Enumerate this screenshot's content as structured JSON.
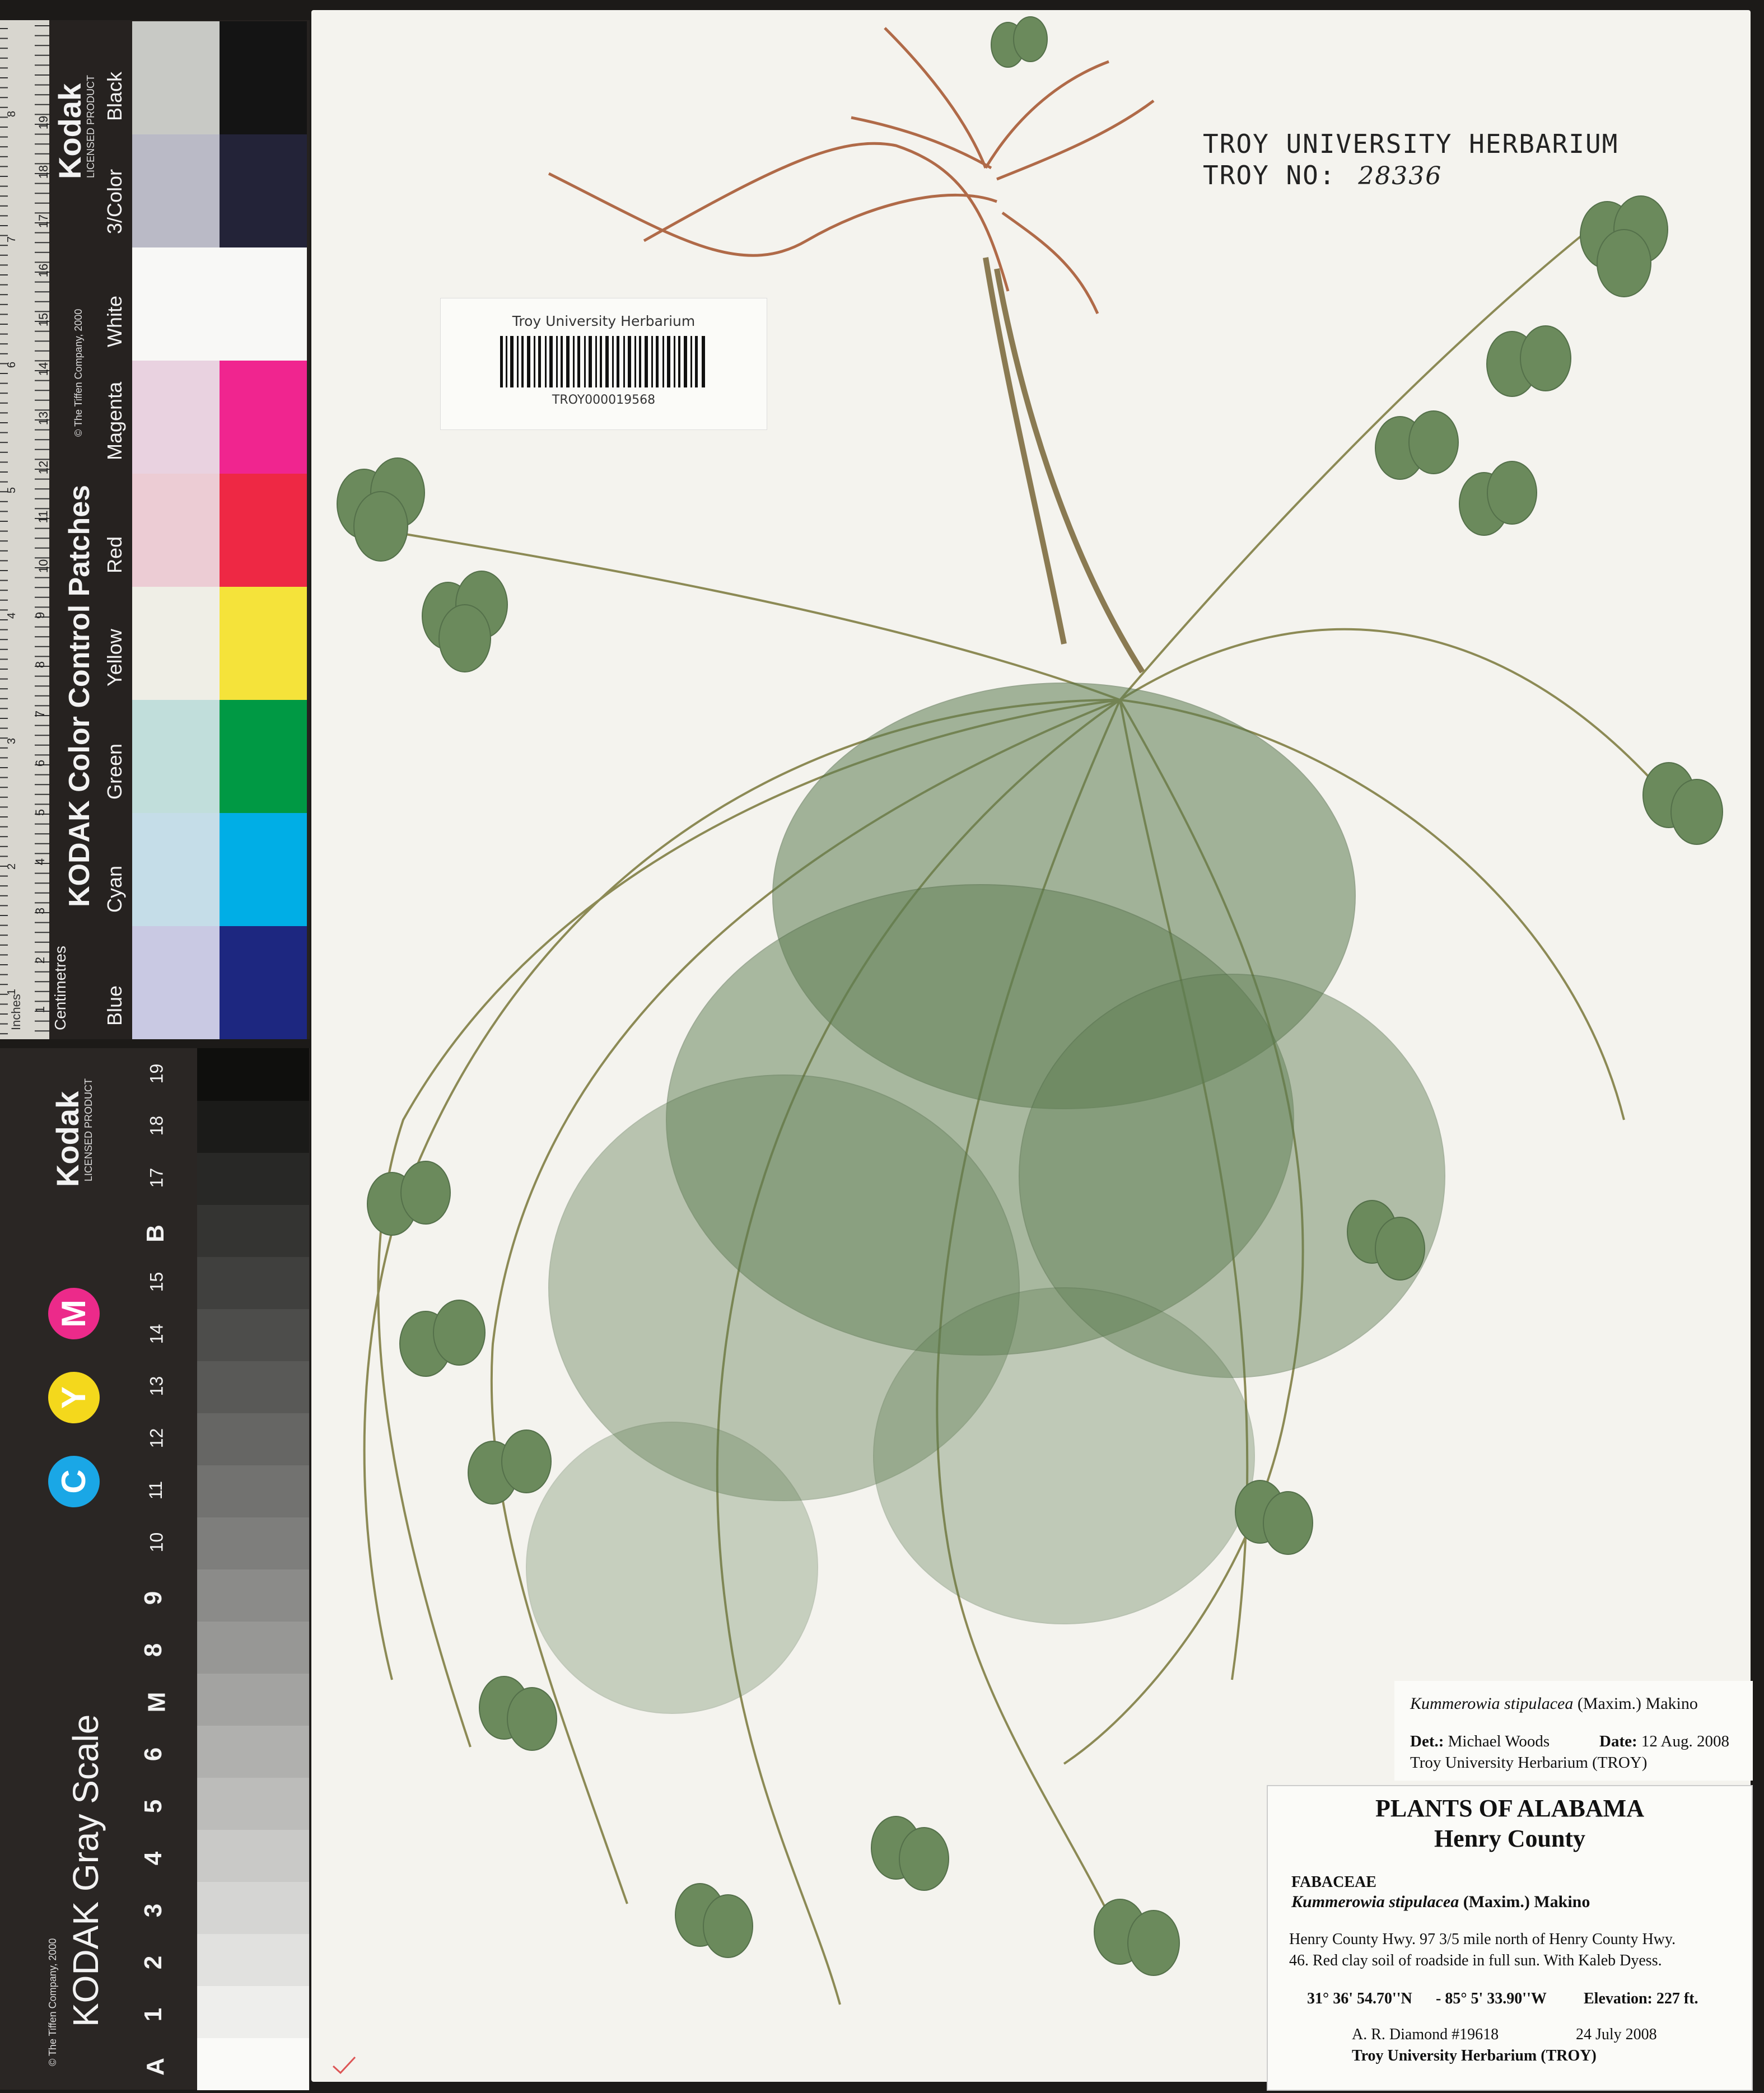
{
  "sheet": {
    "stamp_line1": "TROY UNIVERSITY HERBARIUM",
    "stamp_line2_prefix": "TROY NO:",
    "stamp_line2_number": "28336"
  },
  "barcode_label": {
    "title": "Troy University Herbarium",
    "code": "TROY000019568"
  },
  "determination": {
    "taxon": "Kummerowia stipulacea",
    "author": "(Maxim.) Makino",
    "det_label": "Det.:",
    "det_name": "Michael Woods",
    "date_label": "Date:",
    "date_value": "12 Aug. 2008",
    "institution": "Troy University Herbarium (TROY)"
  },
  "main_label": {
    "heading": "PLANTS OF ALABAMA",
    "county": "Henry County",
    "family": "FABACEAE",
    "taxon": "Kummerowia stipulacea",
    "author": "(Maxim.) Makino",
    "locality_line1": "Henry County Hwy. 97 3/5 mile north of Henry County Hwy.",
    "locality_line2": "46. Red clay soil of roadside in full sun. With Kaleb Dyess.",
    "latitude": "31° 36' 54.70''N",
    "longitude": "- 85° 5' 33.90''W",
    "elevation": "Elevation: 227 ft.",
    "collector": "A. R. Diamond #19618",
    "collection_date": "24 July 2008",
    "institution": "Troy University Herbarium (TROY)"
  },
  "color_card": {
    "title": "KODAK Color Control Patches",
    "copyright": "© The Tiffen Company, 2000",
    "brand": "Kodak",
    "licensed": "LICENSED PRODUCT",
    "units_cm": "Centimetres",
    "units_in": "Inches",
    "patch_labels": [
      "Blue",
      "Cyan",
      "Green",
      "Yellow",
      "Red",
      "Magenta",
      "White",
      "3/Color",
      "Black"
    ],
    "colors": {
      "blue": "#1d2780",
      "cyan": "#00aee6",
      "green": "#009944",
      "yellow": "#f5e33a",
      "red": "#ee2844",
      "magenta": "#f0258f",
      "white": "#f8f8f6",
      "three_color": "#232338",
      "black": "#141414"
    },
    "cm_ticks": [
      "1",
      "2",
      "3",
      "4",
      "5",
      "6",
      "7",
      "8",
      "9",
      "10",
      "11",
      "12",
      "13",
      "14",
      "15",
      "16",
      "17",
      "18",
      "19"
    ],
    "in_ticks": [
      "1",
      "2",
      "3",
      "4",
      "5",
      "6",
      "7",
      "8"
    ]
  },
  "gray_card": {
    "title": "KODAK Gray Scale",
    "copyright": "© The Tiffen Company, 2000",
    "brand": "Kodak",
    "licensed": "LICENSED PRODUCT",
    "cmy": [
      "C",
      "Y",
      "M"
    ],
    "steps": [
      "A",
      "1",
      "2",
      "3",
      "4",
      "5",
      "6",
      "M",
      "8",
      "9",
      "10",
      "11",
      "12",
      "13",
      "14",
      "15",
      "B",
      "17",
      "18",
      "19"
    ]
  }
}
